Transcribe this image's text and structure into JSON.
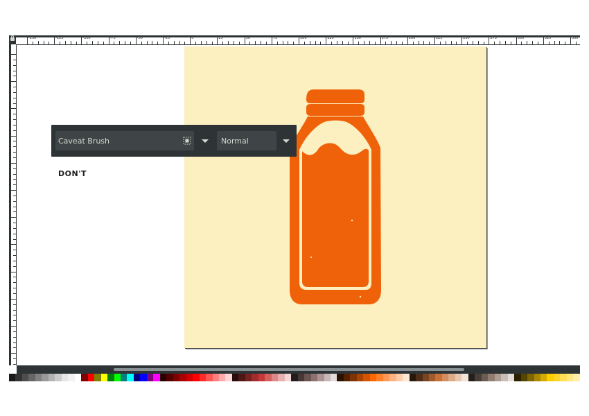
{
  "ruler": {
    "top_labels": [
      "-150",
      "-125",
      "-100",
      "-75",
      "-50",
      "-25",
      "0",
      "25",
      "50",
      "75",
      "100",
      "125",
      "150",
      "175",
      "200",
      "225",
      "250",
      "275",
      "300",
      "325",
      "350"
    ]
  },
  "toolbar": {
    "font_family": "Caveat Brush",
    "font_style": "Normal",
    "font_family_icon": "font-collection-icon",
    "dropdown_icon": "chevron-down-icon"
  },
  "canvas": {
    "text": "DON'T",
    "page_color": "#fcf0c0",
    "bottle_color": "#f0620a"
  },
  "palette": {
    "colors": [
      "#1a1a1a",
      "#333333",
      "#4d4d4d",
      "#666666",
      "#808080",
      "#999999",
      "#b3b3b3",
      "#cccccc",
      "#e6e6e6",
      "#f2f2f2",
      "#ffffff",
      "#800000",
      "#ff0000",
      "#808000",
      "#ffff00",
      "#008000",
      "#00ff00",
      "#008080",
      "#00ffff",
      "#000080",
      "#0000ff",
      "#800080",
      "#ff00ff",
      "#2b0000",
      "#550000",
      "#800000",
      "#aa0000",
      "#d40000",
      "#ff0000",
      "#ff2a2a",
      "#ff5555",
      "#ff8080",
      "#ffaaaa",
      "#ffd5d5",
      "#280b0b",
      "#501616",
      "#782121",
      "#a02c2c",
      "#c83737",
      "#d35f5f",
      "#de8787",
      "#e9afaf",
      "#f4d7d7",
      "#241c1c",
      "#483737",
      "#6c5353",
      "#916f6f",
      "#ac9393",
      "#c8b7b7",
      "#e3dbdb",
      "#2b1100",
      "#552200",
      "#803300",
      "#aa4400",
      "#d45500",
      "#ff6600",
      "#ff7f2a",
      "#ff9955",
      "#ffb380",
      "#ffccaa",
      "#ffe6d5",
      "#28170b",
      "#502d16",
      "#784421",
      "#a05a2c",
      "#c87137",
      "#d38d5f",
      "#deaa87",
      "#e9c6af",
      "#f4e3d7",
      "#241f1c",
      "#483e37",
      "#6c5d53",
      "#917c6f",
      "#ac9d93",
      "#c8beb7",
      "#e3dedb",
      "#2b2200",
      "#554400",
      "#806600",
      "#aa8800",
      "#d4aa00",
      "#ffcc00",
      "#ffd42a",
      "#ffdd55",
      "#ffe680",
      "#ffeeaa"
    ]
  }
}
